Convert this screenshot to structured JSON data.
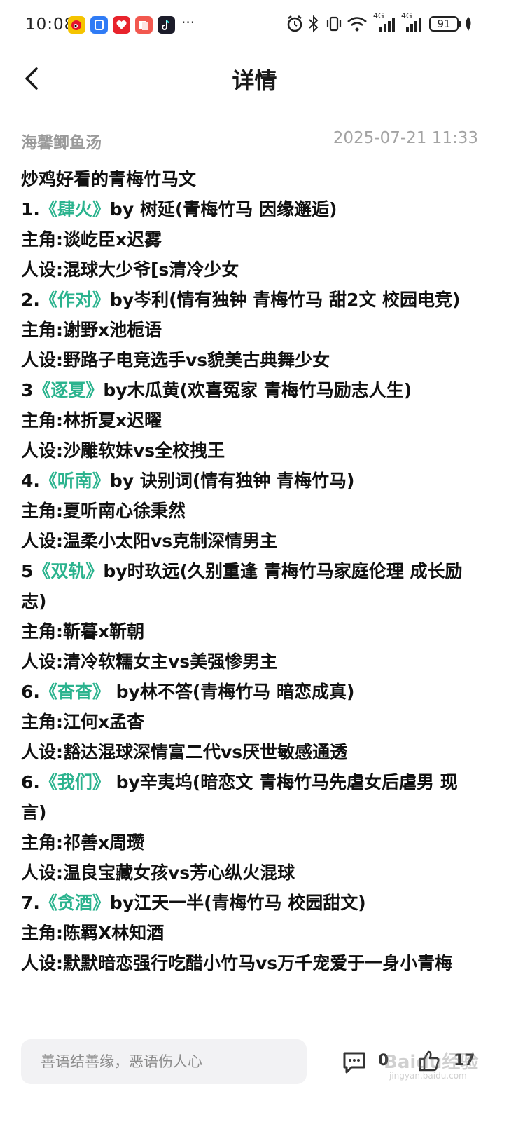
{
  "status_bar": {
    "time": "10:08",
    "battery": "91",
    "network_1": "4G",
    "network_2": "4G",
    "more": "···",
    "icons": [
      "weibo-icon",
      "app-blue-icon",
      "app-red-icon",
      "app-pink-icon",
      "tiktok-icon",
      "alarm-icon",
      "bluetooth-icon",
      "vibrate-icon",
      "wifi-icon",
      "signal-icon",
      "signal-icon",
      "battery-icon",
      "leaf-icon"
    ]
  },
  "header": {
    "title": "详情"
  },
  "post": {
    "author": "海馨鲫鱼汤",
    "date": "2025-07-21 11:33",
    "intro": "炒鸡好看的青梅竹马文",
    "entries": [
      {
        "num": "1.",
        "book": "《肆火》",
        "rest": "by 树延(青梅竹马 因缘邂逅)",
        "protagonists": "主角:谈屹臣x迟雾",
        "persona": "人设:混球大少爷[s清冷少女"
      },
      {
        "num": "2.",
        "book": "《作对》",
        "rest": "by岑利(情有独钟 青梅竹马 甜2文 校园电竞)",
        "protagonists": "主角:谢野x池栀语",
        "persona": "人设:野路子电竞选手vs貌美古典舞少女"
      },
      {
        "num": "3",
        "book": "《逐夏》",
        "rest": "by木瓜黄(欢喜冤家 青梅竹马励志人生)",
        "protagonists": "主角:林折夏x迟曜",
        "persona": "人设:沙雕软妹vs全校拽王"
      },
      {
        "num": "4.",
        "book": "《听南》",
        "rest": "by 诀别词(情有独钟 青梅竹马)",
        "protagonists": "主角:夏听南心徐秉然",
        "persona": "人设:温柔小太阳vs克制深情男主"
      },
      {
        "num": "5",
        "book": "《双轨》",
        "rest": "by时玖远(久别重逢 青梅竹马家庭伦理 成长励志)",
        "protagonists": "主角:靳暮x靳朝",
        "persona": "人设:清冷软糯女主vs美强惨男主"
      },
      {
        "num": "6.",
        "book": "《杳杳》",
        "rest": " by林不答(青梅竹马 暗恋成真)",
        "protagonists": "主角:江何x孟杳",
        "persona": "人设:豁达混球深情富二代vs厌世敏感通透"
      },
      {
        "num": "6.",
        "book": "《我们》",
        "rest": " by辛夷坞(暗恋文 青梅竹马先虐女后虐男 现言)",
        "protagonists": "主角:祁善x周瓒",
        "persona": "人设:温良宝藏女孩vs芳心纵火混球"
      },
      {
        "num": "7.",
        "book": "《贪酒》",
        "rest": "by江天一半(青梅竹马 校园甜文)",
        "protagonists": "主角:陈羁X林知酒",
        "persona": "人设:默默暗恋强行吃醋小竹马vs万千宠爱于一身小青梅"
      }
    ]
  },
  "bottom_bar": {
    "comment_placeholder": "善语结善缘，恶语伤人心",
    "comment_count": "0",
    "like_count": "17",
    "watermark": "Baidu经验",
    "watermark_url": "jingyan.baidu.com"
  },
  "colors": {
    "book_title": "#2bb38e",
    "meta_text": "#9a9a9a",
    "input_bg": "#f2f2f4"
  }
}
